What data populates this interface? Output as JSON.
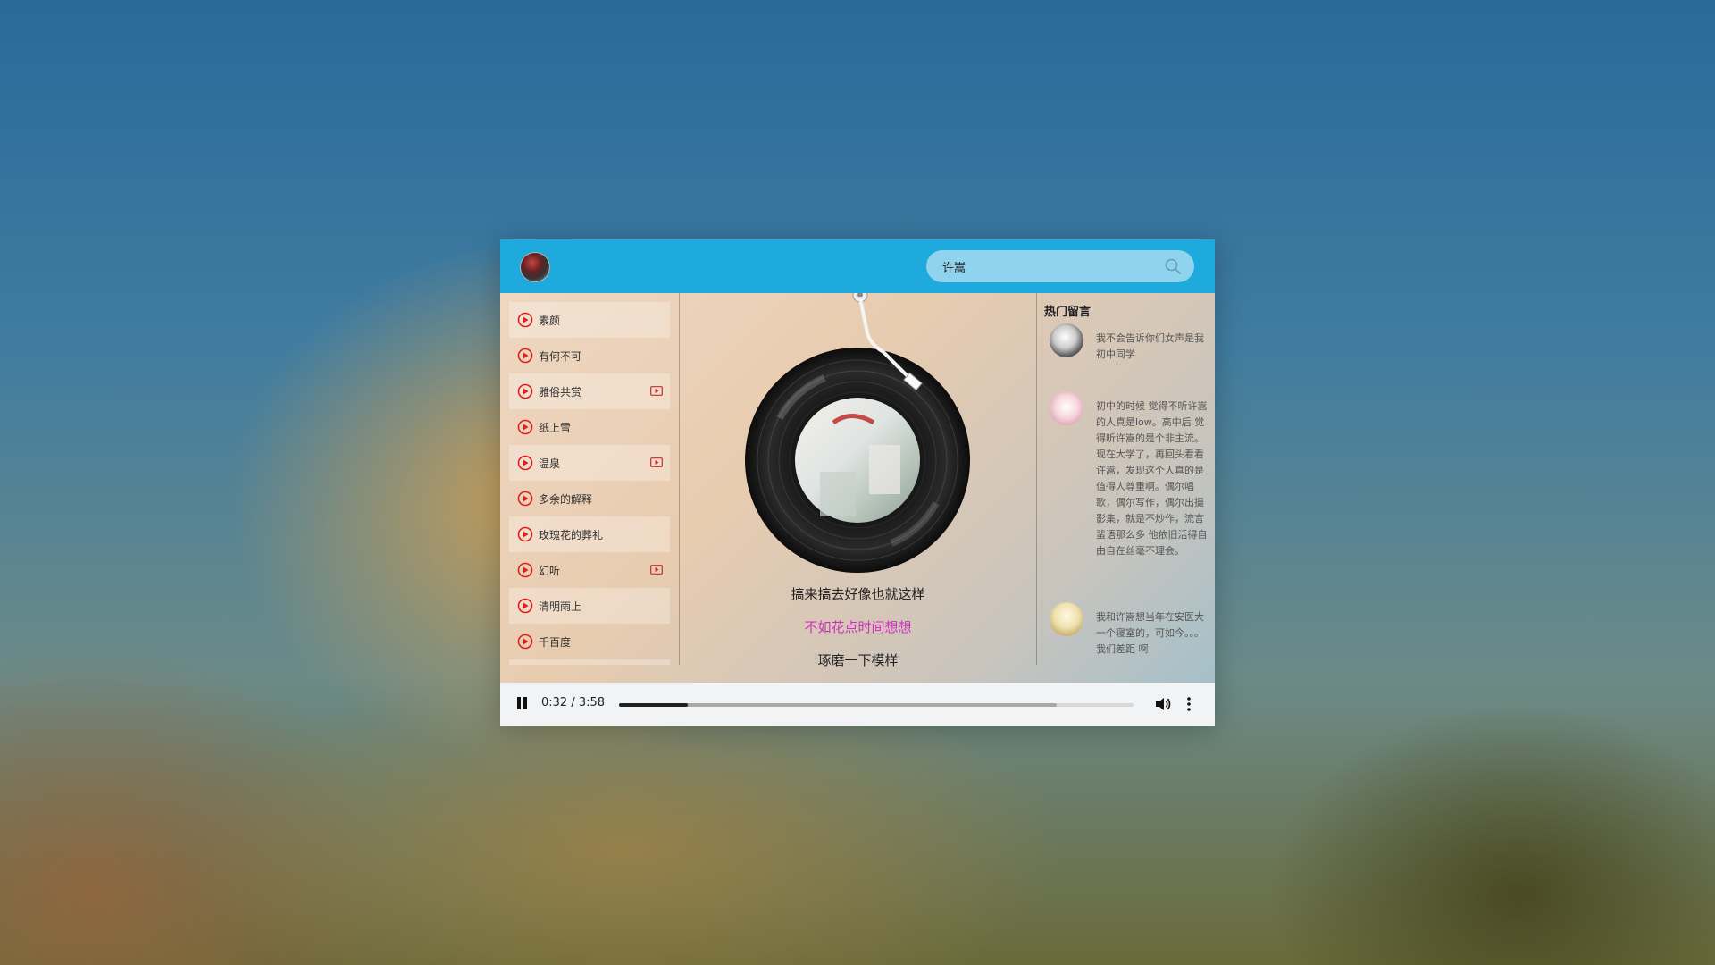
{
  "search": {
    "value": "许嵩"
  },
  "songs": [
    {
      "title": "素颜",
      "has_mv": false
    },
    {
      "title": "有何不可",
      "has_mv": false
    },
    {
      "title": "雅俗共赏",
      "has_mv": true
    },
    {
      "title": "纸上雪",
      "has_mv": false
    },
    {
      "title": "温泉",
      "has_mv": true
    },
    {
      "title": "多余的解释",
      "has_mv": false
    },
    {
      "title": "玫瑰花的葬礼",
      "has_mv": false
    },
    {
      "title": "幻听",
      "has_mv": true
    },
    {
      "title": "清明雨上",
      "has_mv": false
    },
    {
      "title": "千百度",
      "has_mv": false
    }
  ],
  "lyrics": [
    {
      "text": "搞来搞去好像也就这样",
      "active": false
    },
    {
      "text": "不如花点时间想想",
      "active": true
    },
    {
      "text": "琢磨一下模样",
      "active": false
    }
  ],
  "comments": {
    "heading": "热门留言",
    "items": [
      {
        "text": "我不会告诉你们女声是我初中同学"
      },
      {
        "text": "初中的时候 觉得不听许嵩的人真是low。高中后 觉得听许嵩的是个非主流。现在大学了，再回头看看许嵩，发现这个人真的是值得人尊重啊。偶尔唱歌，偶尔写作，偶尔出摄影集，就是不炒作，流言蜚语那么多 他依旧活得自由自在丝毫不理会。"
      },
      {
        "text": "我和许嵩想当年在安医大一个寝室的，可如今。。。我们差距 啊"
      }
    ]
  },
  "player": {
    "time_display": "0:32 / 3:58",
    "current_seconds": 32,
    "duration_seconds": 238,
    "buffered_fraction": 0.85
  },
  "colors": {
    "topbar": "#1eaadc",
    "active_lyric": "#d030c0",
    "play_icon": "#e02020"
  }
}
